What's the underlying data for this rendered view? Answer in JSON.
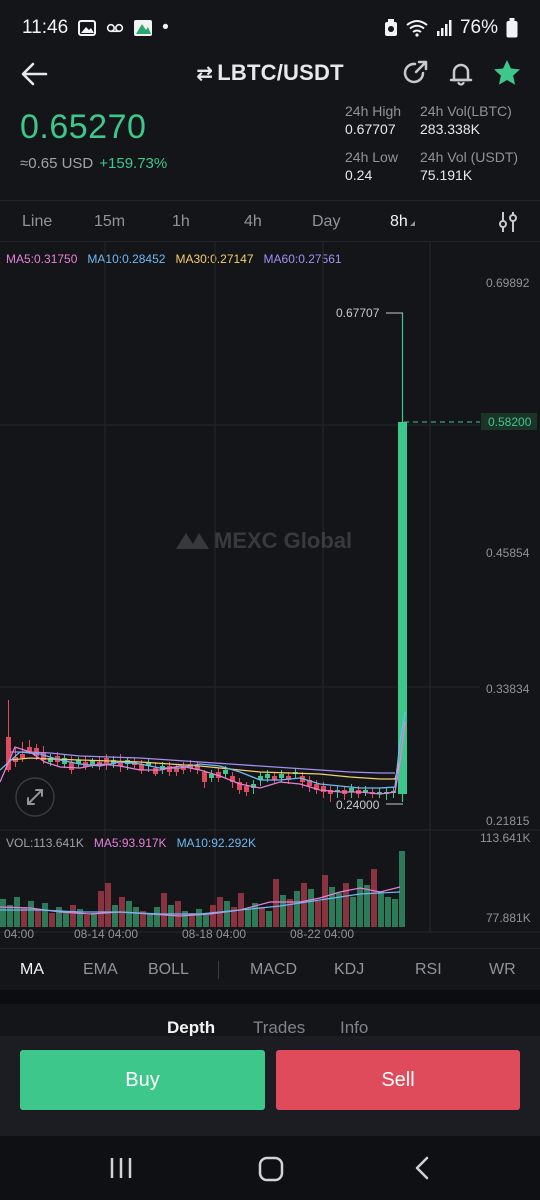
{
  "status_bar": {
    "time": "11:46",
    "dot": "•",
    "battery": "76%"
  },
  "header": {
    "pair": "LBTC/USDT",
    "swap_glyph": "⇄"
  },
  "price": {
    "last": "0.65270",
    "approx": "≈0.65 USD",
    "change": "+159.73%"
  },
  "stats": {
    "high_label": "24h High",
    "high_value": "0.67707",
    "vol_lbtc_label": "24h Vol(LBTC)",
    "vol_lbtc_value": "283.338K",
    "low_label": "24h Low",
    "low_value": "0.24",
    "vol_usdt_label": "24h Vol (USDT)",
    "vol_usdt_value": "75.191K"
  },
  "timeframes": [
    "Line",
    "15m",
    "1h",
    "4h",
    "Day",
    "8h"
  ],
  "active_timeframe": "8h",
  "ma_legend": {
    "ma5": "MA5:0.31750",
    "ma10": "MA10:0.28452",
    "ma30": "MA30:0.27147",
    "ma60": "MA60:0.27561"
  },
  "chart": {
    "watermark": "MEXC Global",
    "price_axis": [
      "0.69892",
      "0.58200",
      "0.45854",
      "0.33834",
      "0.21815"
    ],
    "high_marker": "0.67707",
    "low_marker": "0.24000",
    "date_labels": [
      "04:00",
      "08-14 04:00",
      "08-18 04:00",
      "08-22 04:00"
    ],
    "vol_axis": [
      "113.641K",
      "77.881K"
    ],
    "colors": {
      "up": "#3ec78b",
      "down": "#e04b5c"
    }
  },
  "vol_legend": {
    "vol": "VOL:113.641K",
    "ma5": "MA5:93.917K",
    "ma10": "MA10:92.292K"
  },
  "indicators": [
    "MA",
    "EMA",
    "BOLL",
    "MACD",
    "KDJ",
    "RSI",
    "WR"
  ],
  "bottom_tabs": [
    "Depth",
    "Trades",
    "Info"
  ],
  "buttons": {
    "buy": "Buy",
    "sell": "Sell"
  }
}
